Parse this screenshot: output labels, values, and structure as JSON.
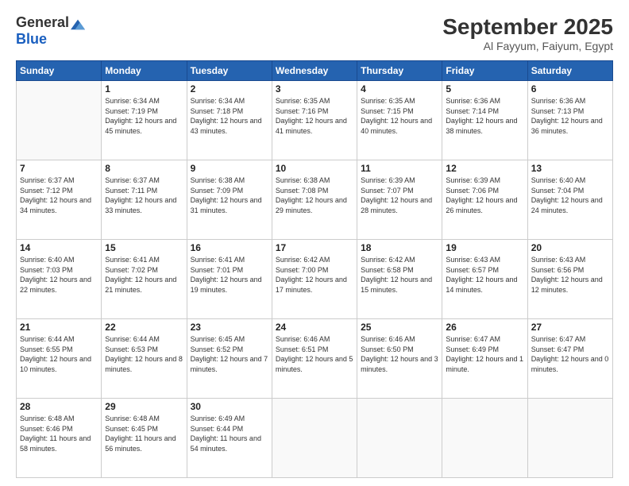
{
  "header": {
    "logo_general": "General",
    "logo_blue": "Blue",
    "title": "September 2025",
    "location": "Al Fayyum, Faiyum, Egypt"
  },
  "weekdays": [
    "Sunday",
    "Monday",
    "Tuesday",
    "Wednesday",
    "Thursday",
    "Friday",
    "Saturday"
  ],
  "weeks": [
    [
      {
        "day": "",
        "sunrise": "",
        "sunset": "",
        "daylight": ""
      },
      {
        "day": "1",
        "sunrise": "Sunrise: 6:34 AM",
        "sunset": "Sunset: 7:19 PM",
        "daylight": "Daylight: 12 hours and 45 minutes."
      },
      {
        "day": "2",
        "sunrise": "Sunrise: 6:34 AM",
        "sunset": "Sunset: 7:18 PM",
        "daylight": "Daylight: 12 hours and 43 minutes."
      },
      {
        "day": "3",
        "sunrise": "Sunrise: 6:35 AM",
        "sunset": "Sunset: 7:16 PM",
        "daylight": "Daylight: 12 hours and 41 minutes."
      },
      {
        "day": "4",
        "sunrise": "Sunrise: 6:35 AM",
        "sunset": "Sunset: 7:15 PM",
        "daylight": "Daylight: 12 hours and 40 minutes."
      },
      {
        "day": "5",
        "sunrise": "Sunrise: 6:36 AM",
        "sunset": "Sunset: 7:14 PM",
        "daylight": "Daylight: 12 hours and 38 minutes."
      },
      {
        "day": "6",
        "sunrise": "Sunrise: 6:36 AM",
        "sunset": "Sunset: 7:13 PM",
        "daylight": "Daylight: 12 hours and 36 minutes."
      }
    ],
    [
      {
        "day": "7",
        "sunrise": "Sunrise: 6:37 AM",
        "sunset": "Sunset: 7:12 PM",
        "daylight": "Daylight: 12 hours and 34 minutes."
      },
      {
        "day": "8",
        "sunrise": "Sunrise: 6:37 AM",
        "sunset": "Sunset: 7:11 PM",
        "daylight": "Daylight: 12 hours and 33 minutes."
      },
      {
        "day": "9",
        "sunrise": "Sunrise: 6:38 AM",
        "sunset": "Sunset: 7:09 PM",
        "daylight": "Daylight: 12 hours and 31 minutes."
      },
      {
        "day": "10",
        "sunrise": "Sunrise: 6:38 AM",
        "sunset": "Sunset: 7:08 PM",
        "daylight": "Daylight: 12 hours and 29 minutes."
      },
      {
        "day": "11",
        "sunrise": "Sunrise: 6:39 AM",
        "sunset": "Sunset: 7:07 PM",
        "daylight": "Daylight: 12 hours and 28 minutes."
      },
      {
        "day": "12",
        "sunrise": "Sunrise: 6:39 AM",
        "sunset": "Sunset: 7:06 PM",
        "daylight": "Daylight: 12 hours and 26 minutes."
      },
      {
        "day": "13",
        "sunrise": "Sunrise: 6:40 AM",
        "sunset": "Sunset: 7:04 PM",
        "daylight": "Daylight: 12 hours and 24 minutes."
      }
    ],
    [
      {
        "day": "14",
        "sunrise": "Sunrise: 6:40 AM",
        "sunset": "Sunset: 7:03 PM",
        "daylight": "Daylight: 12 hours and 22 minutes."
      },
      {
        "day": "15",
        "sunrise": "Sunrise: 6:41 AM",
        "sunset": "Sunset: 7:02 PM",
        "daylight": "Daylight: 12 hours and 21 minutes."
      },
      {
        "day": "16",
        "sunrise": "Sunrise: 6:41 AM",
        "sunset": "Sunset: 7:01 PM",
        "daylight": "Daylight: 12 hours and 19 minutes."
      },
      {
        "day": "17",
        "sunrise": "Sunrise: 6:42 AM",
        "sunset": "Sunset: 7:00 PM",
        "daylight": "Daylight: 12 hours and 17 minutes."
      },
      {
        "day": "18",
        "sunrise": "Sunrise: 6:42 AM",
        "sunset": "Sunset: 6:58 PM",
        "daylight": "Daylight: 12 hours and 15 minutes."
      },
      {
        "day": "19",
        "sunrise": "Sunrise: 6:43 AM",
        "sunset": "Sunset: 6:57 PM",
        "daylight": "Daylight: 12 hours and 14 minutes."
      },
      {
        "day": "20",
        "sunrise": "Sunrise: 6:43 AM",
        "sunset": "Sunset: 6:56 PM",
        "daylight": "Daylight: 12 hours and 12 minutes."
      }
    ],
    [
      {
        "day": "21",
        "sunrise": "Sunrise: 6:44 AM",
        "sunset": "Sunset: 6:55 PM",
        "daylight": "Daylight: 12 hours and 10 minutes."
      },
      {
        "day": "22",
        "sunrise": "Sunrise: 6:44 AM",
        "sunset": "Sunset: 6:53 PM",
        "daylight": "Daylight: 12 hours and 8 minutes."
      },
      {
        "day": "23",
        "sunrise": "Sunrise: 6:45 AM",
        "sunset": "Sunset: 6:52 PM",
        "daylight": "Daylight: 12 hours and 7 minutes."
      },
      {
        "day": "24",
        "sunrise": "Sunrise: 6:46 AM",
        "sunset": "Sunset: 6:51 PM",
        "daylight": "Daylight: 12 hours and 5 minutes."
      },
      {
        "day": "25",
        "sunrise": "Sunrise: 6:46 AM",
        "sunset": "Sunset: 6:50 PM",
        "daylight": "Daylight: 12 hours and 3 minutes."
      },
      {
        "day": "26",
        "sunrise": "Sunrise: 6:47 AM",
        "sunset": "Sunset: 6:49 PM",
        "daylight": "Daylight: 12 hours and 1 minute."
      },
      {
        "day": "27",
        "sunrise": "Sunrise: 6:47 AM",
        "sunset": "Sunset: 6:47 PM",
        "daylight": "Daylight: 12 hours and 0 minutes."
      }
    ],
    [
      {
        "day": "28",
        "sunrise": "Sunrise: 6:48 AM",
        "sunset": "Sunset: 6:46 PM",
        "daylight": "Daylight: 11 hours and 58 minutes."
      },
      {
        "day": "29",
        "sunrise": "Sunrise: 6:48 AM",
        "sunset": "Sunset: 6:45 PM",
        "daylight": "Daylight: 11 hours and 56 minutes."
      },
      {
        "day": "30",
        "sunrise": "Sunrise: 6:49 AM",
        "sunset": "Sunset: 6:44 PM",
        "daylight": "Daylight: 11 hours and 54 minutes."
      },
      {
        "day": "",
        "sunrise": "",
        "sunset": "",
        "daylight": ""
      },
      {
        "day": "",
        "sunrise": "",
        "sunset": "",
        "daylight": ""
      },
      {
        "day": "",
        "sunrise": "",
        "sunset": "",
        "daylight": ""
      },
      {
        "day": "",
        "sunrise": "",
        "sunset": "",
        "daylight": ""
      }
    ]
  ]
}
